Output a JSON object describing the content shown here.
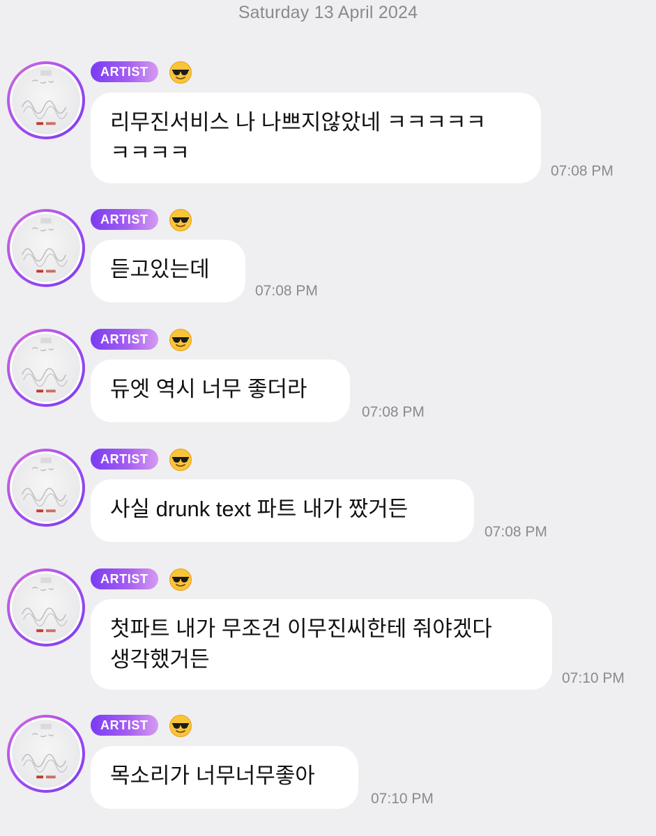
{
  "date_header": "Saturday 13 April 2024",
  "sender": {
    "badge_label": "ARTIST",
    "status_emoji": "smiling-face-with-sunglasses",
    "avatar": "album-cover-scribble-avatar"
  },
  "colors": {
    "background": "#efeff1",
    "bubble": "#ffffff",
    "badge_gradient_start": "#7a3cf3",
    "badge_gradient_end": "#d69af2",
    "avatar_ring": "#a24cf0",
    "timestamp": "#8a8a8e"
  },
  "messages": [
    {
      "lines": [
        "리무진서비스 나 나쁘지않았네 ㅋㅋㅋㅋㅋ",
        "ㅋㅋㅋㅋ"
      ],
      "time": "07:08 PM"
    },
    {
      "lines": [
        "듣고있는데"
      ],
      "time": "07:08 PM"
    },
    {
      "lines": [
        "듀엣 역시 너무 좋더라"
      ],
      "time": "07:08 PM"
    },
    {
      "lines": [
        "사실 drunk text 파트 내가 짰거든"
      ],
      "time": "07:08 PM"
    },
    {
      "lines": [
        "첫파트 내가 무조건 이무진씨한테 줘야겠다",
        "생각했거든"
      ],
      "time": "07:10 PM"
    },
    {
      "lines": [
        "목소리가 너무너무좋아"
      ],
      "time": "07:10 PM"
    }
  ]
}
